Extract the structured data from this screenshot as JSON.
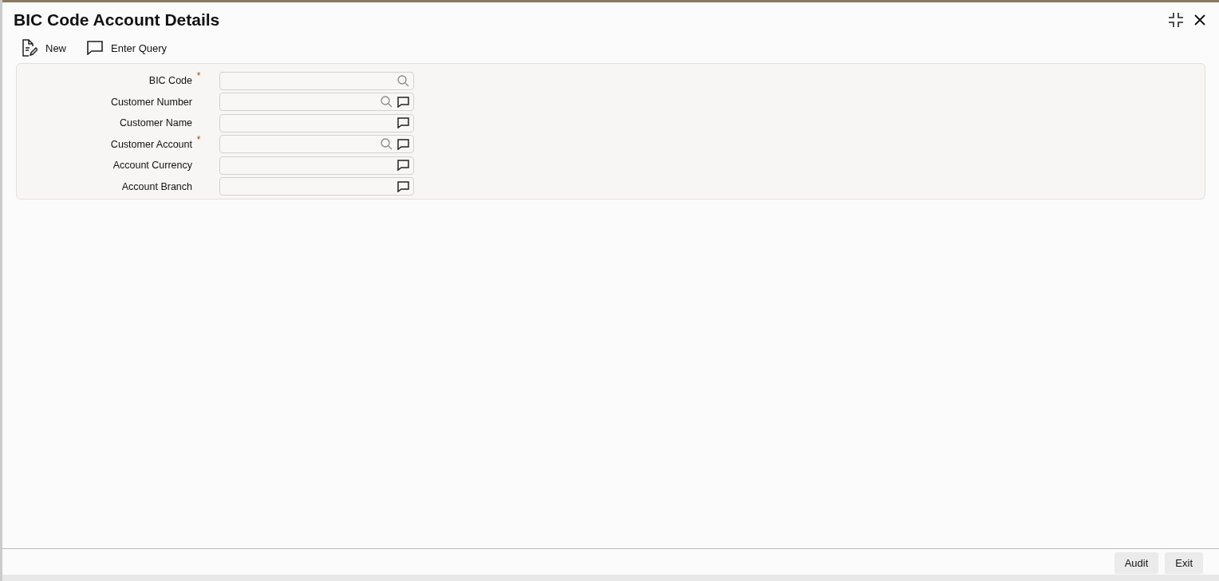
{
  "window": {
    "title": "BIC Code Account Details"
  },
  "toolbar": [
    {
      "label": "New",
      "kind": "new"
    },
    {
      "label": "Enter Query",
      "kind": "query"
    }
  ],
  "fields": [
    {
      "label": "BIC Code",
      "required": true,
      "search": true,
      "comment": false
    },
    {
      "label": "Customer Number",
      "required": false,
      "search": true,
      "comment": true
    },
    {
      "label": "Customer Name",
      "required": false,
      "search": false,
      "comment": true
    },
    {
      "label": "Customer Account",
      "required": true,
      "search": true,
      "comment": true
    },
    {
      "label": "Account Currency",
      "required": false,
      "search": false,
      "comment": true
    },
    {
      "label": "Account Branch",
      "required": false,
      "search": false,
      "comment": true
    }
  ],
  "required_mark": "*",
  "footer_buttons": [
    "Audit",
    "Exit"
  ]
}
